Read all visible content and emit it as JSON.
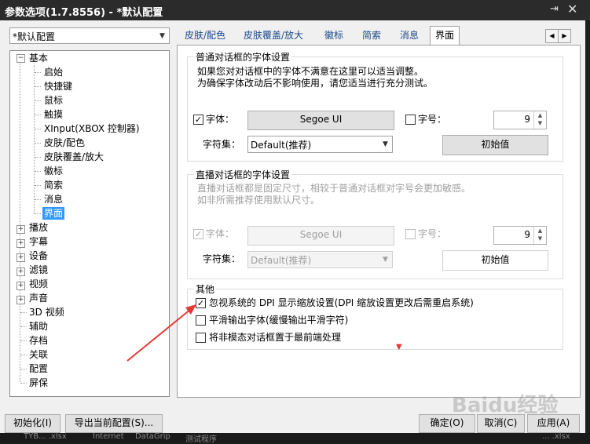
{
  "window": {
    "title": "参数选项(1.7.8556) - *默认配置",
    "pin_glyph": "⇥",
    "close_glyph": "✕"
  },
  "profile": {
    "value": "*默认配置"
  },
  "tree": {
    "root_basic": "基本",
    "children": [
      "启始",
      "快捷键",
      "鼠标",
      "触摸",
      "XInput(XBOX 控制器)",
      "皮肤/配色",
      "皮肤覆盖/放大",
      "徽标",
      "简索",
      "消息",
      "界面"
    ],
    "groups": [
      "播放",
      "字幕",
      "设备",
      "滤镜",
      "视频",
      "声音"
    ],
    "leaves": [
      "3D 视频",
      "辅助",
      "存档",
      "关联",
      "配置",
      "屏保"
    ]
  },
  "tabs": [
    "皮肤/配色",
    "皮肤覆盖/放大",
    "徽标",
    "简索",
    "消息",
    "界面"
  ],
  "group1": {
    "title": "普通对话框的字体设置",
    "desc1": "如果您对对话框中的字体不满意在这里可以适当调整。",
    "desc2": "为确保字体改动后不影响使用，请您适当进行充分测试。",
    "font_label": "字体：",
    "font_value": "Segoe UI",
    "size_label": "字号：",
    "size_value": "9",
    "charset_label": "字符集：",
    "charset_value": "Default(推荐)",
    "reset_label": "初始值"
  },
  "group2": {
    "title": "直播对话框的字体设置",
    "desc1": "直播对话框都是固定尺寸，相较于普通对话框对字号会更加敏感。",
    "desc2": "如非所需推荐使用默认尺寸。",
    "font_label": "字体：",
    "font_value": "Segoe UI",
    "size_label": "字号：",
    "size_value": "9",
    "charset_label": "字符集：",
    "charset_value": "Default(推荐)",
    "reset_label": "初始值"
  },
  "group3": {
    "title": "其他",
    "opt1": "忽视系统的 DPI 显示缩放设置(DPI 缩放设置更改后需重启系统)",
    "opt2": "平滑输出字体(缓慢输出平滑字符)",
    "opt3": "将非模态对话框置于最前端处理"
  },
  "footer": {
    "reset": "初始化(I)",
    "export": "导出当前配置(S)...",
    "ok": "确定(O)",
    "cancel": "取消(C)",
    "apply": "应用(A)"
  },
  "taskbar": [
    "TYB... .xlsx",
    "Internet",
    "DataGrip",
    "测试程序",
    "... .xlsx"
  ],
  "watermark": "Baidu经验",
  "colors": {
    "accent": "#3399ff",
    "arrow": "#e53935"
  }
}
